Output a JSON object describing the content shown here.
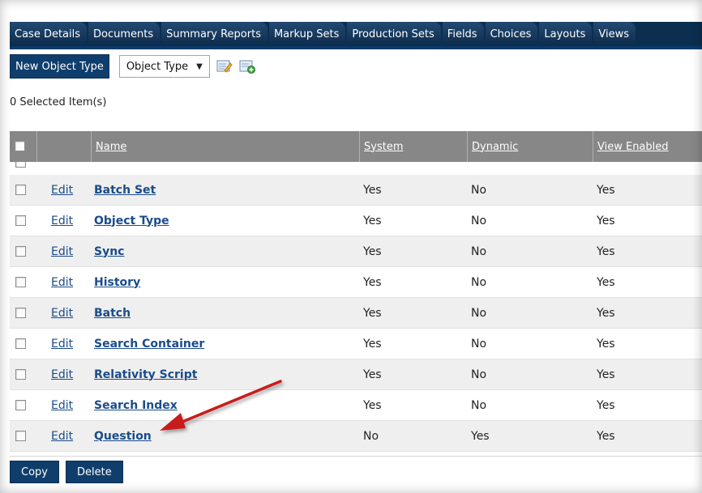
{
  "tabs": [
    "Case Details",
    "Documents",
    "Summary Reports",
    "Markup Sets",
    "Production Sets",
    "Fields",
    "Choices",
    "Layouts",
    "Views"
  ],
  "toolbar": {
    "new_button": "New Object Type",
    "select_value": "Object Type",
    "icons": [
      "edit-view-icon",
      "new-view-icon"
    ]
  },
  "selected_count": "0 Selected Item(s)",
  "table": {
    "columns": [
      "Name",
      "System",
      "Dynamic",
      "View Enabled"
    ],
    "edit_label": "Edit",
    "rows": [
      {
        "name": "Batch Set",
        "system": "Yes",
        "dynamic": "No",
        "view_enabled": "Yes"
      },
      {
        "name": "Object Type",
        "system": "Yes",
        "dynamic": "No",
        "view_enabled": "Yes"
      },
      {
        "name": "Sync",
        "system": "Yes",
        "dynamic": "No",
        "view_enabled": "Yes"
      },
      {
        "name": "History",
        "system": "Yes",
        "dynamic": "No",
        "view_enabled": "Yes"
      },
      {
        "name": "Batch",
        "system": "Yes",
        "dynamic": "No",
        "view_enabled": "Yes"
      },
      {
        "name": "Search Container",
        "system": "Yes",
        "dynamic": "No",
        "view_enabled": "Yes"
      },
      {
        "name": "Relativity Script",
        "system": "Yes",
        "dynamic": "No",
        "view_enabled": "Yes"
      },
      {
        "name": "Search Index",
        "system": "Yes",
        "dynamic": "No",
        "view_enabled": "Yes"
      },
      {
        "name": "Question",
        "system": "No",
        "dynamic": "Yes",
        "view_enabled": "Yes"
      }
    ]
  },
  "footer": {
    "copy_button": "Copy",
    "delete_button": "Delete"
  },
  "colors": {
    "nav_dark": "#0c2e4f",
    "button_blue": "#0f3e6c",
    "header_gray": "#878787",
    "link_blue": "#1a4c8a",
    "annotation_red": "#c81e1e"
  }
}
